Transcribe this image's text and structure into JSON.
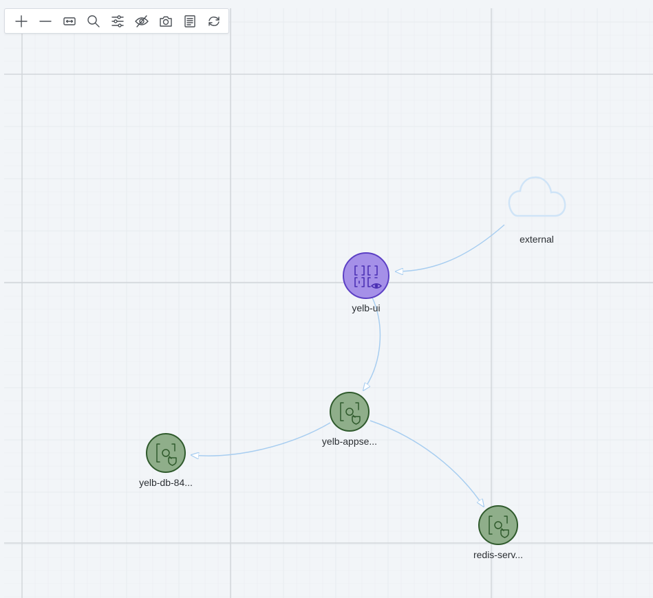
{
  "toolbar": {
    "tools": [
      {
        "name": "zoom-in",
        "icon": "plus-icon"
      },
      {
        "name": "zoom-out",
        "icon": "minus-icon"
      },
      {
        "name": "fit-to-screen",
        "icon": "fit-icon"
      },
      {
        "name": "search",
        "icon": "search-icon"
      },
      {
        "name": "filter",
        "icon": "sliders-icon"
      },
      {
        "name": "hide",
        "icon": "eye-off-icon"
      },
      {
        "name": "screenshot",
        "icon": "camera-icon"
      },
      {
        "name": "legend",
        "icon": "document-icon"
      },
      {
        "name": "refresh",
        "icon": "refresh-icon"
      }
    ]
  },
  "graph": {
    "nodes": {
      "external": {
        "label": "external",
        "kind": "cloud-icon",
        "color": "#cfe4f7"
      },
      "yelb_ui": {
        "label": "yelb-ui",
        "kind": "service-icon",
        "color": "#a590e8",
        "border": "#5b3fc4"
      },
      "yelb_appserver": {
        "label": "yelb-appse...",
        "kind": "workload-icon",
        "color": "#8fae8a",
        "border": "#2f5a2c"
      },
      "yelb_db": {
        "label": "yelb-db-84...",
        "kind": "workload-icon",
        "color": "#8fae8a",
        "border": "#2f5a2c"
      },
      "redis_server": {
        "label": "redis-serv...",
        "kind": "workload-icon",
        "color": "#8fae8a",
        "border": "#2f5a2c"
      }
    },
    "edges": [
      {
        "from": "external",
        "to": "yelb_ui"
      },
      {
        "from": "yelb_ui",
        "to": "yelb_appserver"
      },
      {
        "from": "yelb_appserver",
        "to": "yelb_db"
      },
      {
        "from": "yelb_appserver",
        "to": "redis_server"
      }
    ],
    "edge_color": "#a7cdf0",
    "grid_minor_color": "#e1e6eb",
    "grid_major_color": "#d2d6da"
  }
}
